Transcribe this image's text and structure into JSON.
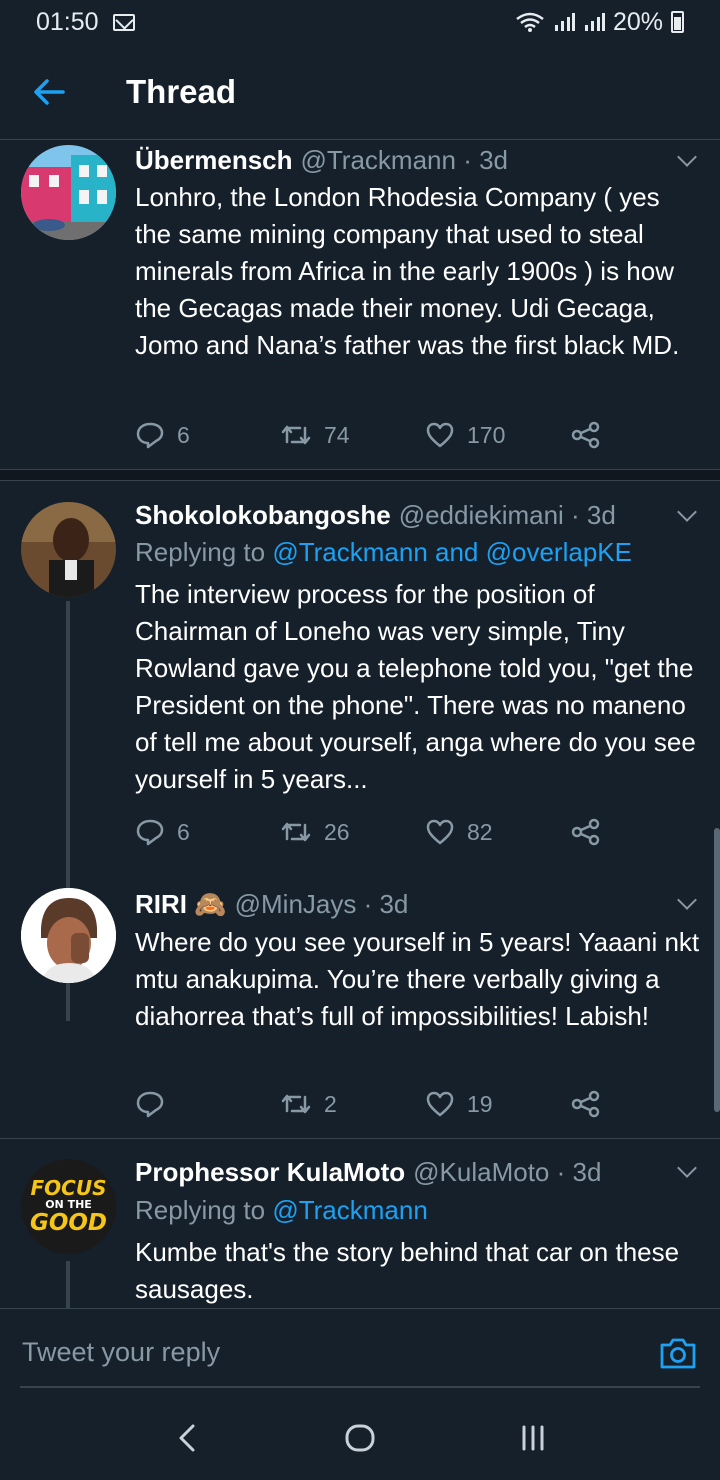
{
  "status_bar": {
    "time": "01:50",
    "battery": "20%"
  },
  "header": {
    "title": "Thread"
  },
  "tweets": [
    {
      "name": "Übermensch",
      "handle": "@Trackmann · 3d",
      "replying_prefix": "",
      "replying_to": "",
      "text": "Lonhro, the London Rhodesia Company ( yes the same mining company that used to steal minerals from Africa in the early 1900s ) is how the Gecagas made their money. Udi Gecaga, Jomo and Nana’s father was the first black MD.",
      "replies": "6",
      "retweets": "74",
      "likes": "170"
    },
    {
      "name": "Shokolokobangoshe",
      "handle": "@eddiekimani · 3d",
      "replying_prefix": "Replying to",
      "replying_to": "@Trackmann and @overlapKE",
      "text": "The interview process for the position of Chairman of Loneho was very simple, Tiny Rowland gave you a telephone told you, \"get the President on the phone\". There was no maneno of tell me about yourself, anga where do you see yourself in 5 years...",
      "replies": "6",
      "retweets": "26",
      "likes": "82"
    },
    {
      "name": "RIRI 🙈",
      "handle": "@MinJays · 3d",
      "replying_prefix": "",
      "replying_to": "",
      "text": "Where do you see yourself in 5 years! Yaaani nkt mtu anakupima. You’re there verbally giving a diahorrea that’s full of impossibilities! Labish!",
      "replies": "",
      "retweets": "2",
      "likes": "19"
    },
    {
      "name": "Prophessor KulaMoto",
      "handle": "@KulaMoto · 3d",
      "replying_prefix": "Replying to",
      "replying_to": "@Trackmann",
      "avatar_text": [
        "FOCUS",
        "ON THE",
        "GOOD"
      ],
      "text": "Kumbe that's the story behind that car on these sausages.",
      "replies": "",
      "retweets": "",
      "likes": ""
    }
  ],
  "reply_bar": {
    "placeholder": "Tweet your reply"
  },
  "colors": {
    "background": "#15202b",
    "accent": "#1da1f2",
    "muted": "#8899a6",
    "divider": "#38444d"
  }
}
